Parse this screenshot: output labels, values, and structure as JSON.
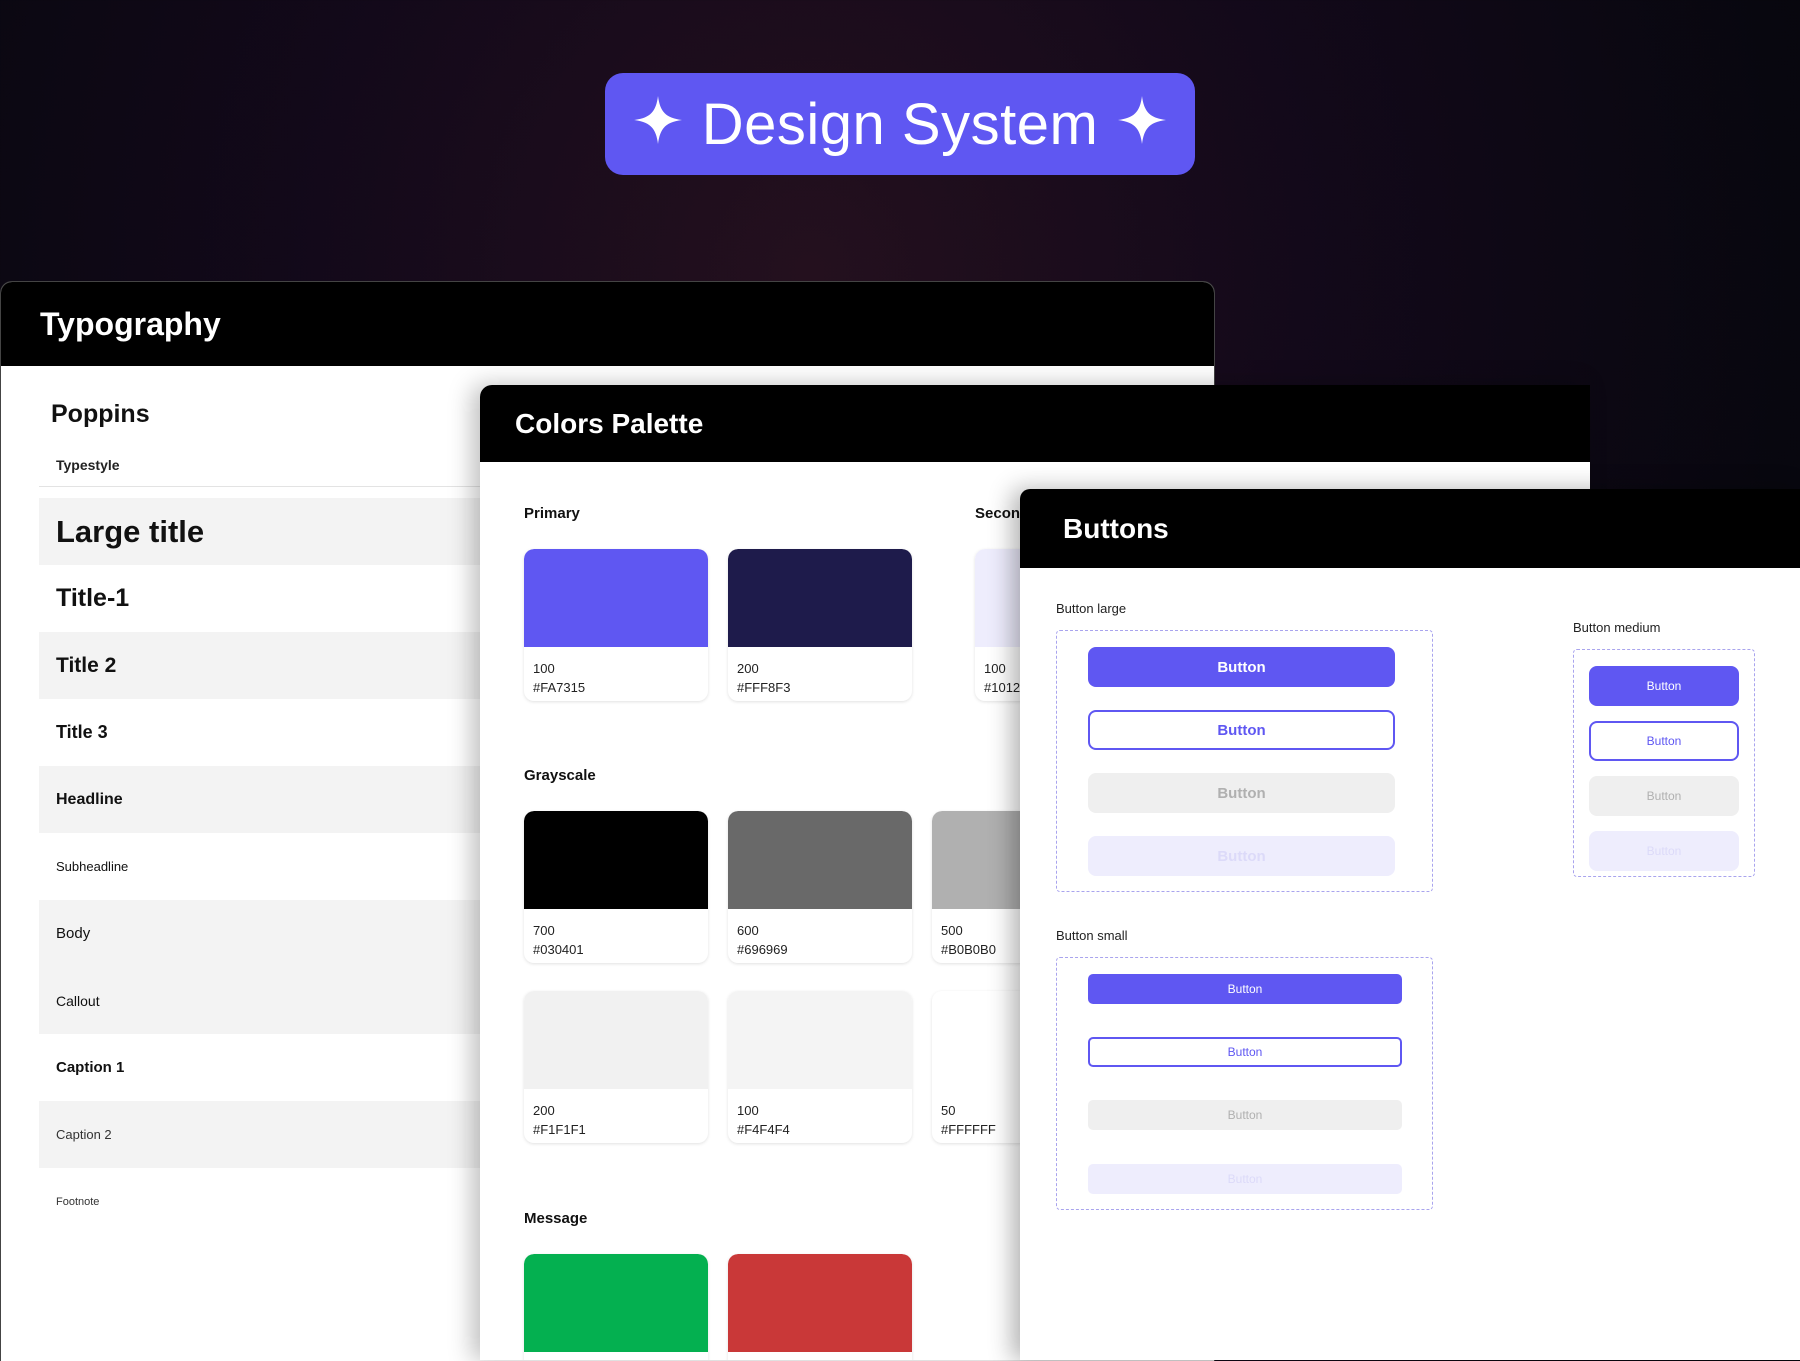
{
  "hero": {
    "title": "Design System",
    "background": "#5f57f2"
  },
  "typography": {
    "title": "Typography",
    "font_name": "Poppins",
    "typestyle_label": "Typestyle",
    "rows": [
      "Large title",
      "Title-1",
      "Title 2",
      "Title 3",
      "Headline",
      "Subheadline",
      "Body",
      "Callout",
      "Caption 1",
      "Caption 2",
      "Footnote"
    ]
  },
  "colors": {
    "title": "Colors Palette",
    "primary_label": "Primary",
    "secondary_label": "Secon",
    "grayscale_label": "Grayscale",
    "message_label": "Message",
    "primary": [
      {
        "shade": "100",
        "hex": "#FA7315",
        "color": "#5f57f2"
      },
      {
        "shade": "200",
        "hex": "#FFF8F3",
        "color": "#1e1b4b"
      }
    ],
    "secondary": [
      {
        "shade": "100",
        "hex": "#1012",
        "color": "#eeedfd"
      }
    ],
    "grayscale": [
      {
        "shade": "700",
        "hex": "#030401",
        "color": "#000000"
      },
      {
        "shade": "600",
        "hex": "#696969",
        "color": "#696969"
      },
      {
        "shade": "500",
        "hex": "#B0B0B0",
        "color": "#b0b0b0"
      },
      {
        "shade": "200",
        "hex": "#F1F1F1",
        "color": "#f1f1f1"
      },
      {
        "shade": "100",
        "hex": "#F4F4F4",
        "color": "#f4f4f4"
      },
      {
        "shade": "50",
        "hex": "#FFFFFF",
        "color": "#ffffff"
      }
    ],
    "message": [
      {
        "color": "#04b050"
      },
      {
        "color": "#c93838"
      }
    ]
  },
  "buttons": {
    "title": "Buttons",
    "large_label": "Button large",
    "medium_label": "Button medium",
    "small_label": "Button small",
    "button_text": "Button",
    "accent": "#5f57f2"
  }
}
